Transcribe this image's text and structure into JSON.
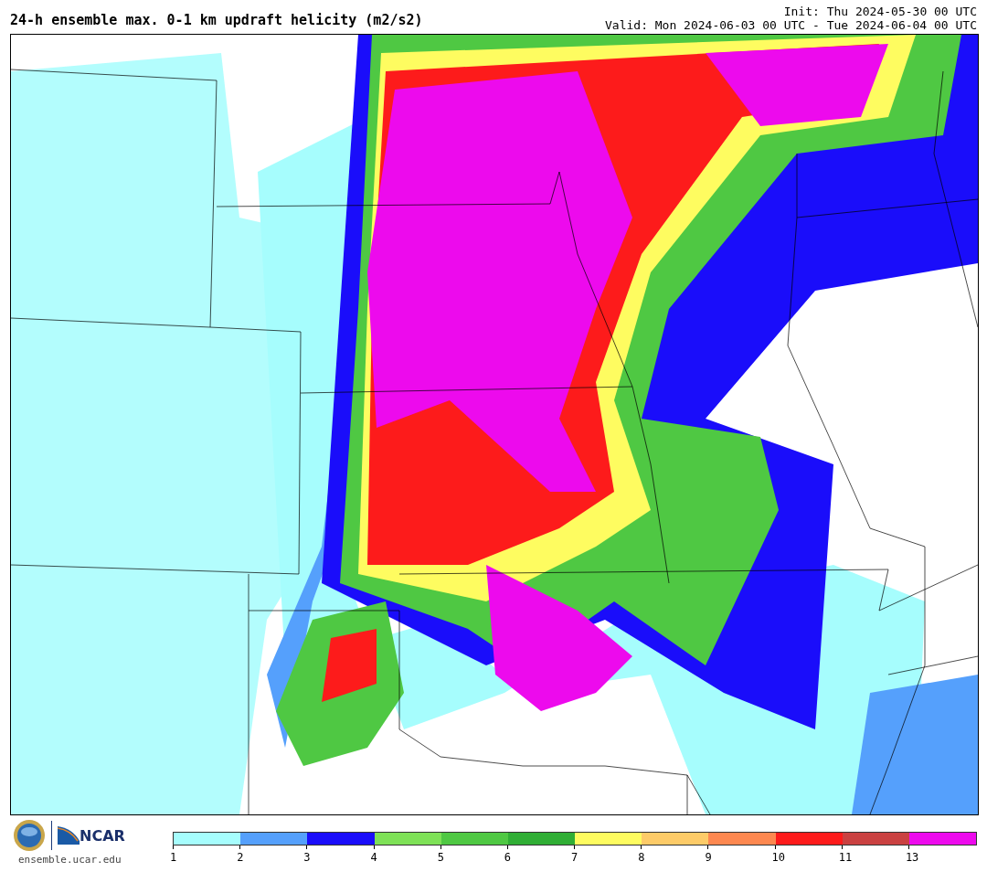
{
  "title": "24-h ensemble max. 0-1 km updraft helicity (m2/s2)",
  "init": "Init: Thu 2024-05-30 00 UTC",
  "valid": "Valid: Mon 2024-06-03 00 UTC - Tue 2024-06-04 00 UTC",
  "logo": {
    "text": "NCAR"
  },
  "site": "ensemble.ucar.edu",
  "colorbar": {
    "segments": [
      {
        "color": "#a6fdfd"
      },
      {
        "color": "#55a0fc"
      },
      {
        "color": "#1a0dfa"
      },
      {
        "color": "#7ee157"
      },
      {
        "color": "#4fc843"
      },
      {
        "color": "#30ae35"
      },
      {
        "color": "#fefc60"
      },
      {
        "color": "#fdcb68"
      },
      {
        "color": "#fd8850"
      },
      {
        "color": "#fd1b1b"
      },
      {
        "color": "#ca4141"
      },
      {
        "color": "#ed0aed"
      }
    ],
    "ticks": [
      "1",
      "2",
      "3",
      "4",
      "5",
      "6",
      "7",
      "8",
      "9",
      "10",
      "11",
      "13"
    ]
  }
}
